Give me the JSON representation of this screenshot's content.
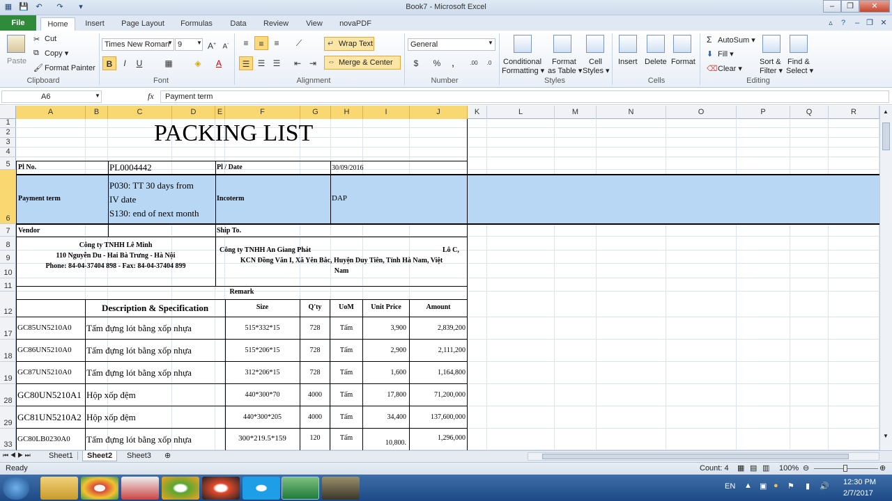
{
  "window": {
    "title": "Book7 - Microsoft Excel"
  },
  "tabs": {
    "file": "File",
    "home": "Home",
    "insert": "Insert",
    "page_layout": "Page Layout",
    "formulas": "Formulas",
    "data": "Data",
    "review": "Review",
    "view": "View",
    "novapdf": "novaPDF"
  },
  "ribbon": {
    "clipboard": {
      "paste": "Paste",
      "cut": "Cut",
      "copy": "Copy ▾",
      "format_painter": "Format Painter",
      "label": "Clipboard"
    },
    "font": {
      "name": "Times New Roman",
      "size": "9",
      "label": "Font"
    },
    "alignment": {
      "wrap_text": "Wrap Text",
      "merge_center": "Merge & Center",
      "label": "Alignment"
    },
    "number": {
      "format": "General",
      "label": "Number"
    },
    "styles": {
      "conditional": "Conditional",
      "formatting": "Formatting ▾",
      "format_as": "Format",
      "as_table": "as Table ▾",
      "cell": "Cell",
      "styles_btn": "Styles ▾",
      "label": "Styles"
    },
    "cells": {
      "insert": "Insert",
      "delete": "Delete",
      "format": "Format",
      "label": "Cells"
    },
    "editing": {
      "autosum": "AutoSum ▾",
      "fill": "Fill ▾",
      "clear": "Clear ▾",
      "sort": "Sort &",
      "filter": "Filter ▾",
      "find": "Find &",
      "select": "Select ▾",
      "label": "Editing"
    }
  },
  "formula_bar": {
    "name_box": "A6",
    "fx": "fx",
    "content": "Payment term"
  },
  "columns": [
    "A",
    "B",
    "C",
    "D",
    "E",
    "F",
    "G",
    "H",
    "I",
    "J",
    "K",
    "L",
    "M",
    "N",
    "O",
    "P",
    "Q",
    "R"
  ],
  "rows": [
    "1",
    "2",
    "3",
    "4",
    "5",
    "6",
    "7",
    "8",
    "9",
    "10",
    "11",
    "12",
    "17",
    "18",
    "19",
    "28",
    "29",
    "33"
  ],
  "doc": {
    "title": "PACKING LIST",
    "pl_no_label": "Pl No.",
    "pl_no": "PL0004442",
    "pl_date_label": "Pl / Date",
    "pl_date": "30/09/2016",
    "payment_term_label": "Payment term",
    "payment_term_1": "P030: TT 30 days from",
    "payment_term_2": "IV date",
    "payment_term_3": "S130: end of next month",
    "incoterm_label": "Incoterm",
    "incoterm": "DAP",
    "vendor_label": "Vendor",
    "ship_to_label": "Ship To.",
    "vendor_1": "Công ty TNHH Lê Minh",
    "vendor_2": "110 Nguyễn Du - Hai Bà Trưng - Hà Nội",
    "vendor_3": "Phone: 84-04-37404 898 - Fax: 84-04-37404 899",
    "ship_1": "Công ty TNHH An Giang Phát",
    "ship_1b": "Lô C,",
    "ship_2": "KCN Đồng Văn I, Xã Yên Bắc, Huyện Duy Tiên, Tỉnh Hà Nam, Việt",
    "ship_3": "Nam",
    "remark": "Remark",
    "headers": {
      "desc": "Description & Specification",
      "size": "Size",
      "qty": "Q'ty",
      "uom": "UoM",
      "unit_price": "Unit Price",
      "amount": "Amount"
    },
    "items": [
      {
        "code": "GC85UN5210A0",
        "desc": "Tấm đựng lót bằng xốp nhựa",
        "size": "515*332*15",
        "qty": "728",
        "uom": "Tấm",
        "price": "3,900",
        "amount": "2,839,200"
      },
      {
        "code": "GC86UN5210A0",
        "desc": "Tấm đựng lót bằng xốp nhựa",
        "size": "515*206*15",
        "qty": "728",
        "uom": "Tấm",
        "price": "2,900",
        "amount": "2,111,200"
      },
      {
        "code": "GC87UN5210A0",
        "desc": "Tấm đựng lót bằng xốp nhựa",
        "size": "312*206*15",
        "qty": "728",
        "uom": "Tấm",
        "price": "1,600",
        "amount": "1,164,800"
      },
      {
        "code": "GC80UN5210A1",
        "desc": "Hộp xốp đệm",
        "size": "440*300*70",
        "qty": "4000",
        "uom": "Tấm",
        "price": "17,800",
        "amount": "71,200,000"
      },
      {
        "code": "GC81UN5210A2",
        "desc": "Hộp xốp đệm",
        "size": "440*300*205",
        "qty": "4000",
        "uom": "Tấm",
        "price": "34,400",
        "amount": "137,600,000"
      },
      {
        "code": "GC80LB0230A0",
        "desc": "Tấm đựng lót bằng xốp nhựa",
        "size": "300*219.5*159",
        "qty": "120",
        "uom": "Tấm",
        "price": "10,800.",
        "amount": "1,296,000"
      }
    ]
  },
  "sheets": [
    "Sheet1",
    "Sheet2",
    "Sheet3"
  ],
  "status": {
    "ready": "Ready",
    "count": "Count: 4",
    "zoom": "100%"
  },
  "taskbar": {
    "lang": "EN",
    "time": "12:30 PM",
    "date": "2/7/2017"
  }
}
